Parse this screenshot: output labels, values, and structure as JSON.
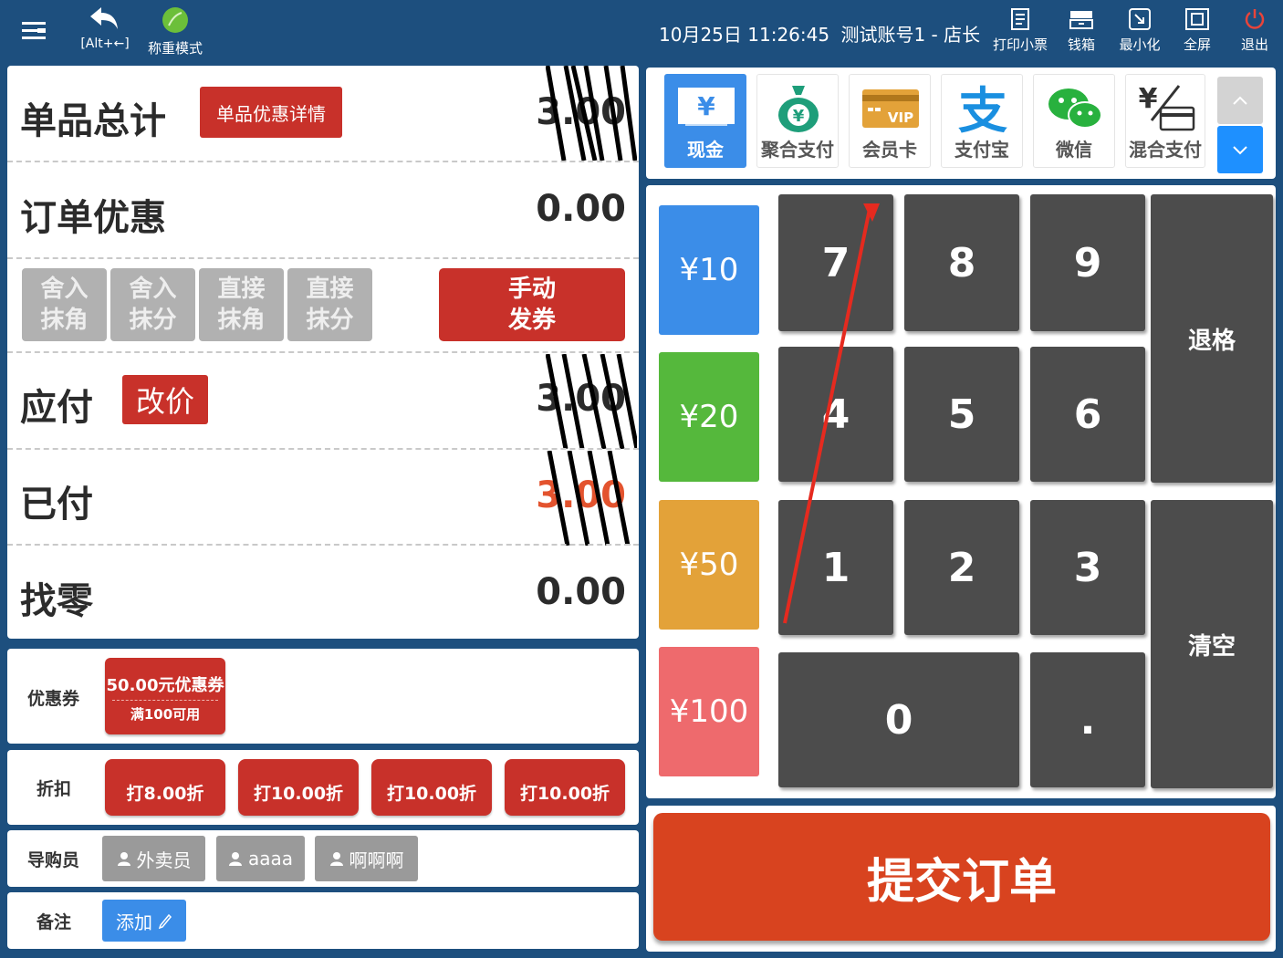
{
  "topbar": {
    "back_label": "[Alt+←]",
    "weigh_label": "称重模式",
    "datetime": "10月25日 11:26:45",
    "account": "测试账号1 - 店长",
    "actions": [
      {
        "label": "打印小票",
        "icon": "receipt-icon"
      },
      {
        "label": "钱箱",
        "icon": "cash-drawer-icon"
      },
      {
        "label": "最小化",
        "icon": "minimize-icon"
      },
      {
        "label": "全屏",
        "icon": "fullscreen-icon"
      },
      {
        "label": "退出",
        "icon": "power-icon"
      }
    ]
  },
  "summary": {
    "item_total_label": "单品总计",
    "item_discount_btn": "单品优惠详情",
    "item_total_value": "3.00",
    "order_discount_label": "订单优惠",
    "order_discount_value": "0.00",
    "rounding": [
      {
        "line1": "舍入",
        "line2": "抹角"
      },
      {
        "line1": "舍入",
        "line2": "抹分"
      },
      {
        "line1": "直接",
        "line2": "抹角"
      },
      {
        "line1": "直接",
        "line2": "抹分"
      }
    ],
    "manual_coupon": {
      "line1": "手动",
      "line2": "发券"
    },
    "payable_label": "应付",
    "change_price_btn": "改价",
    "payable_value": "3.00",
    "paid_label": "已付",
    "paid_value": "3.00",
    "change_label": "找零",
    "change_value": "0.00"
  },
  "coupon": {
    "label": "优惠券",
    "title": "50.00元优惠券",
    "condition": "满100可用"
  },
  "discount": {
    "label": "折扣",
    "options": [
      "打8.00折",
      "打10.00折",
      "打10.00折",
      "打10.00折"
    ]
  },
  "guide": {
    "label": "导购员",
    "people": [
      "外卖员",
      "aaaa",
      "啊啊啊"
    ]
  },
  "remark": {
    "label": "备注",
    "add_btn": "添加"
  },
  "payment_methods": [
    {
      "label": "现金",
      "icon": "yen-cash-icon",
      "active": true
    },
    {
      "label": "聚合支付",
      "icon": "money-bag-icon"
    },
    {
      "label": "会员卡",
      "icon": "vip-card-icon"
    },
    {
      "label": "支付宝",
      "icon": "alipay-icon"
    },
    {
      "label": "微信",
      "icon": "wechat-icon"
    },
    {
      "label": "混合支付",
      "icon": "mixed-pay-icon"
    }
  ],
  "quick_amounts": [
    "¥10",
    "¥20",
    "¥50",
    "¥100"
  ],
  "keypad": {
    "digits": [
      "7",
      "8",
      "9",
      "4",
      "5",
      "6",
      "1",
      "2",
      "3"
    ],
    "zero": "0",
    "dot": ".",
    "backspace": "退格",
    "clear": "清空"
  },
  "submit_label": "提交订单",
  "colors": {
    "header": "#1d4f7e",
    "red": "#c8312a",
    "key": "#4c4c4c",
    "blue": "#3b8de8",
    "green": "#55b83c",
    "orange": "#e3a239",
    "pink": "#ee6a6d",
    "submit": "#d8431f",
    "paid_value": "#e3532e"
  }
}
